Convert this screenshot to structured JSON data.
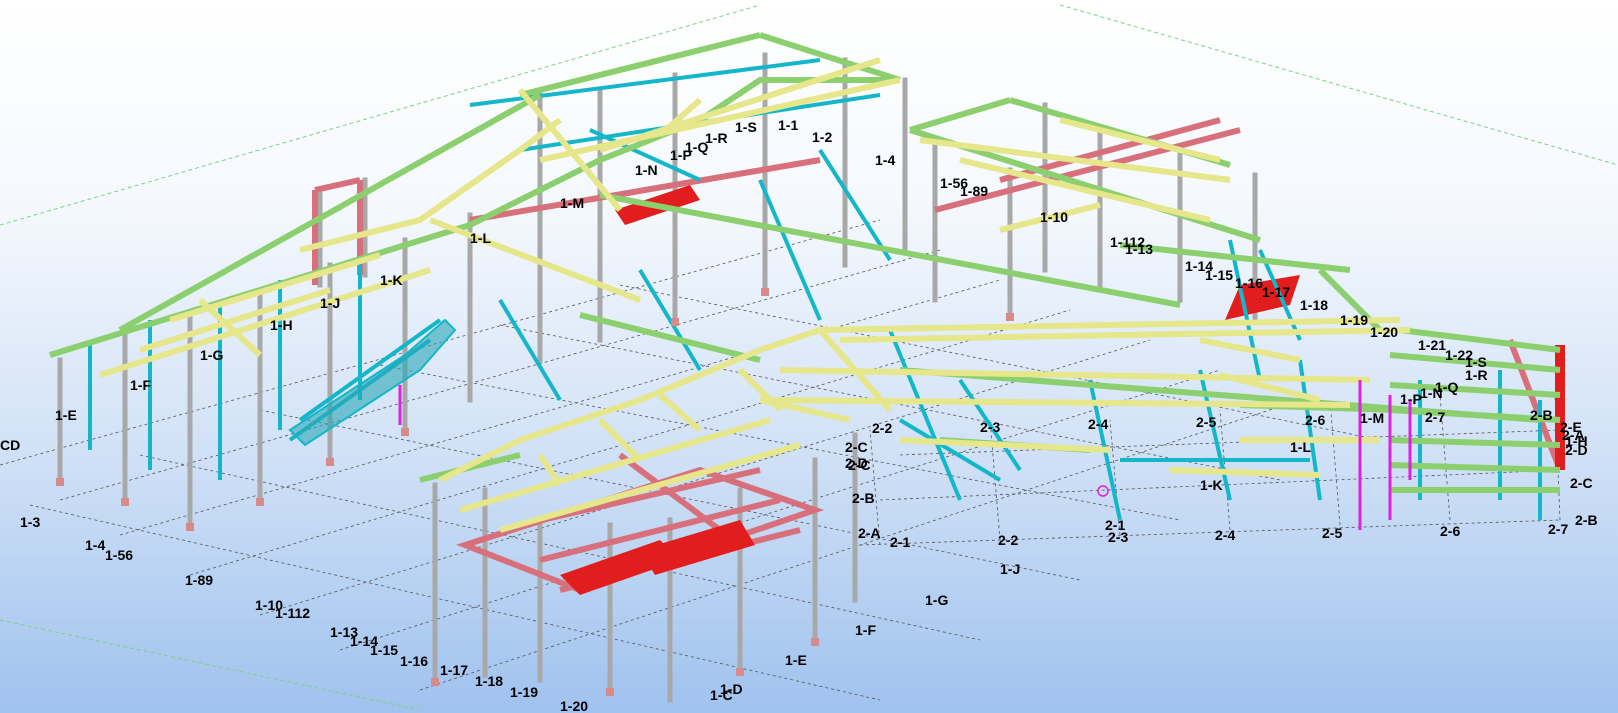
{
  "colors": {
    "background_top": "#ffffff",
    "background_bottom": "#9fc2ee",
    "grid": "#555555",
    "column": "#a8a8a8",
    "beam_yellow": "#e6e68a",
    "beam_green": "#8ccf6e",
    "brace_cyan": "#13b7c9",
    "member_pink": "#d8707c",
    "member_red": "#e21d1d",
    "member_magenta": "#e020e0"
  },
  "grid_labels": {
    "left_axis": [
      "1-3",
      "1-4",
      "1-56",
      "1-89",
      "1-10",
      "1-112",
      "1-13",
      "1-14",
      "1-15",
      "1-16",
      "1-17",
      "1-18",
      "1-19",
      "1-20",
      "CD"
    ],
    "front_axis": [
      "1-E",
      "1-F",
      "1-G",
      "1-H",
      "1-J",
      "1-K",
      "1-L",
      "1-M",
      "1-N",
      "1-P",
      "1-Q",
      "1-R",
      "1-S",
      "1-D",
      "1-C"
    ],
    "row2_bottom": [
      "2-1",
      "2-2",
      "2-3",
      "2-4",
      "2-5",
      "2-6",
      "2-7",
      "2-A",
      "2-B",
      "2-C"
    ],
    "floating": [
      "1-S",
      "1-1",
      "1-2",
      "1-R",
      "1-Q",
      "1-P",
      "1-N",
      "1-M",
      "1-L",
      "1-K",
      "1-J",
      "1-H",
      "1-G",
      "1-F",
      "1-E",
      "1-3",
      "1-4",
      "1-56",
      "1-89",
      "1-10",
      "1-112",
      "1-13",
      "1-14",
      "1-15",
      "1-16",
      "1-17",
      "1-18",
      "1-19",
      "1-20",
      "1-21",
      "1-22",
      "1-S",
      "1-R",
      "1-Q",
      "1-P",
      "1-N",
      "1-M",
      "1-L",
      "1-K",
      "2-1",
      "2-2",
      "2-3",
      "2-4",
      "2-5",
      "2-6",
      "2-7",
      "2-B",
      "2-C",
      "2-D",
      "2-E",
      "2-A",
      "2-B",
      "2-C",
      "2-D",
      "1-H",
      "1-J"
    ]
  }
}
